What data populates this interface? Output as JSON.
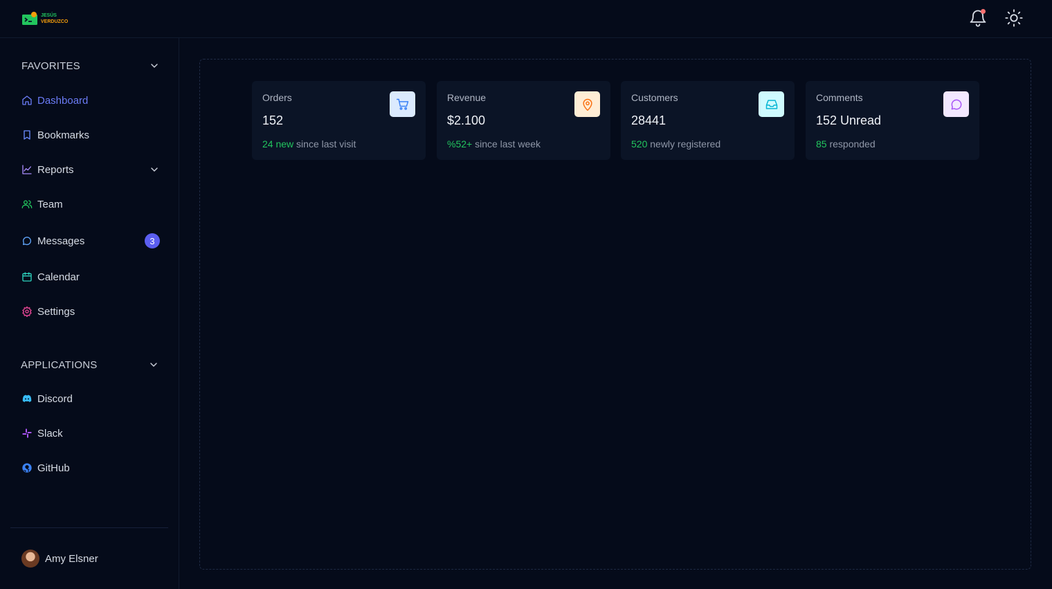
{
  "brand": {
    "line1": "JESÚS",
    "line2": "VERDUZCO",
    "green": "#22c55e",
    "orange": "#f59e0b"
  },
  "topbar": {
    "icons": [
      "bell-icon",
      "sun-icon"
    ],
    "notification_dot_color": "#f87171"
  },
  "sidebar": {
    "favorites_label": "FAVORITES",
    "applications_label": "APPLICATIONS",
    "items": [
      {
        "label": "Dashboard",
        "icon": "home-icon",
        "active": true
      },
      {
        "label": "Bookmarks",
        "icon": "bookmark-icon"
      },
      {
        "label": "Reports",
        "icon": "chart-icon"
      },
      {
        "label": "Team",
        "icon": "users-icon"
      },
      {
        "label": "Messages",
        "icon": "chat-icon",
        "badge": "3"
      },
      {
        "label": "Calendar",
        "icon": "calendar-icon"
      },
      {
        "label": "Settings",
        "icon": "gear-icon"
      }
    ],
    "apps": [
      {
        "label": "Discord",
        "icon": "discord-icon"
      },
      {
        "label": "Slack",
        "icon": "slack-icon"
      },
      {
        "label": "GitHub",
        "icon": "github-icon"
      }
    ],
    "user": {
      "name": "Amy Elsner"
    }
  },
  "cards": [
    {
      "title": "Orders",
      "value": "152",
      "highlight": "24 new",
      "subtext": " since last visit",
      "icon": "cart-icon",
      "icon_bg": "#dbeafe",
      "icon_color": "#3b82f6"
    },
    {
      "title": "Revenue",
      "value": "$2.100",
      "highlight": "%52+",
      "subtext": " since last week",
      "icon": "map-pin-icon",
      "icon_bg": "#ffedd5",
      "icon_color": "#f97316"
    },
    {
      "title": "Customers",
      "value": "28441",
      "highlight": "520",
      "subtext": " newly registered",
      "icon": "inbox-icon",
      "icon_bg": "#cffafe",
      "icon_color": "#06b6d4"
    },
    {
      "title": "Comments",
      "value": "152 Unread",
      "highlight": "85",
      "subtext": " responded",
      "icon": "comment-icon",
      "icon_bg": "#f3e8ff",
      "icon_color": "#a855f7"
    }
  ],
  "colors": {
    "background": "#050b1a",
    "card": "#0b1426",
    "accent": "#6b7cf6",
    "positive": "#22c55e",
    "badge": "#5b5ef0"
  }
}
